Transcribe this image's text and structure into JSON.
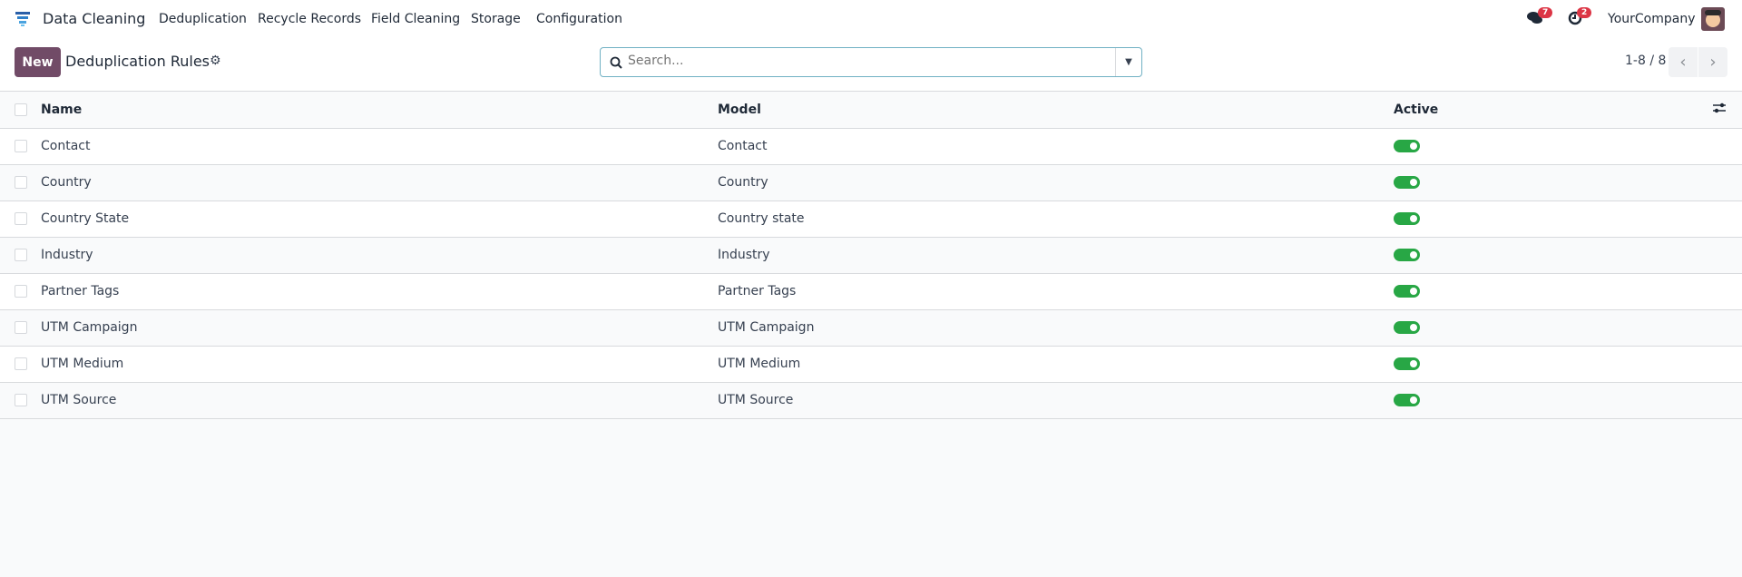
{
  "nav": {
    "app": "Data Cleaning",
    "menu": [
      "Deduplication",
      "Recycle Records",
      "Field Cleaning",
      "Storage",
      "Configuration"
    ],
    "messages_count": "7",
    "activities_count": "2",
    "company": "YourCompany"
  },
  "control": {
    "new_label": "New",
    "title": "Deduplication Rules",
    "search_placeholder": "Search...",
    "pager": "1-8 / 8"
  },
  "table": {
    "headers": [
      "Name",
      "Model",
      "Active"
    ],
    "rows": [
      {
        "name": "Contact",
        "model": "Contact",
        "active": true
      },
      {
        "name": "Country",
        "model": "Country",
        "active": true
      },
      {
        "name": "Country State",
        "model": "Country state",
        "active": true
      },
      {
        "name": "Industry",
        "model": "Industry",
        "active": true
      },
      {
        "name": "Partner Tags",
        "model": "Partner Tags",
        "active": true
      },
      {
        "name": "UTM Campaign",
        "model": "UTM Campaign",
        "active": true
      },
      {
        "name": "UTM Medium",
        "model": "UTM Medium",
        "active": true
      },
      {
        "name": "UTM Source",
        "model": "UTM Source",
        "active": true
      }
    ]
  },
  "colors": {
    "brand": "#714b67",
    "toggle_on": "#28a745",
    "badge": "#dc3545"
  }
}
